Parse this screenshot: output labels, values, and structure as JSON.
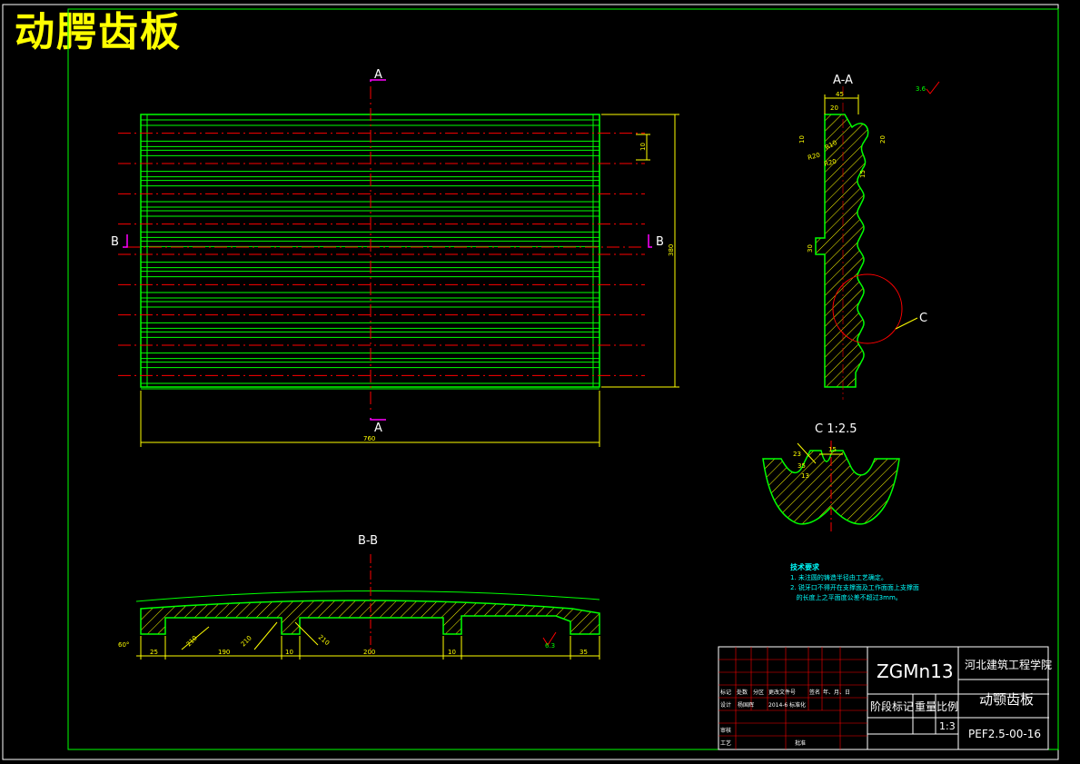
{
  "title": "动腭齿板",
  "colors": {
    "outline": "#00ff00",
    "dimension": "#ffff00",
    "centerline": "#ff0000",
    "section_mark": "#ff00ff",
    "notes": "#00ffff",
    "hatch": "#ffff00",
    "title_block": "#ffffff"
  },
  "views": {
    "front": {
      "section_label_top": "A",
      "section_label_bottom": "A",
      "section_label_left": "B",
      "section_label_right": "B",
      "dim_width": "760",
      "dim_height": "380",
      "dim_pitch": "10"
    },
    "section_aa": {
      "label": "A-A",
      "dims": [
        "45",
        "20",
        "10",
        "R10",
        "R20",
        "R20",
        "20",
        "15",
        "30"
      ],
      "detail_label": "C"
    },
    "detail_c": {
      "label": "C 1:2.5",
      "dims": [
        "23",
        "15",
        "35",
        "13"
      ]
    },
    "section_bb": {
      "label": "B-B",
      "dims": [
        "60°",
        "25",
        "210",
        "190",
        "210",
        "10",
        "210",
        "200",
        "10",
        "35",
        "6.3"
      ]
    },
    "roughness_mark": "3.6"
  },
  "notes": {
    "heading": "技术要求",
    "items": [
      "1. 未注圆的铸造半径由工艺确定。",
      "2. 锐牙口不得开在支撑面及工作面面上支撑面",
      "   的长度上之平面度公差不超过3mm。"
    ]
  },
  "title_block": {
    "material": "ZGMn13",
    "school": "河北建筑工程学院",
    "part_name": "动颚齿板",
    "drawing_no": "PEF2.5-00-16",
    "stage_mark": "阶段标记",
    "weight": "重量",
    "scale_label": "比例",
    "scale": "1:3",
    "row_labels": [
      "标记",
      "处数",
      "分区",
      "更改文件号",
      "签名",
      "年、月、日"
    ],
    "designer_label": "设计",
    "designer": "杨国辉",
    "date": "2014-6",
    "standard_label": "标准化",
    "review_label": "审核",
    "process_label": "工艺",
    "approve_label": "批准"
  }
}
